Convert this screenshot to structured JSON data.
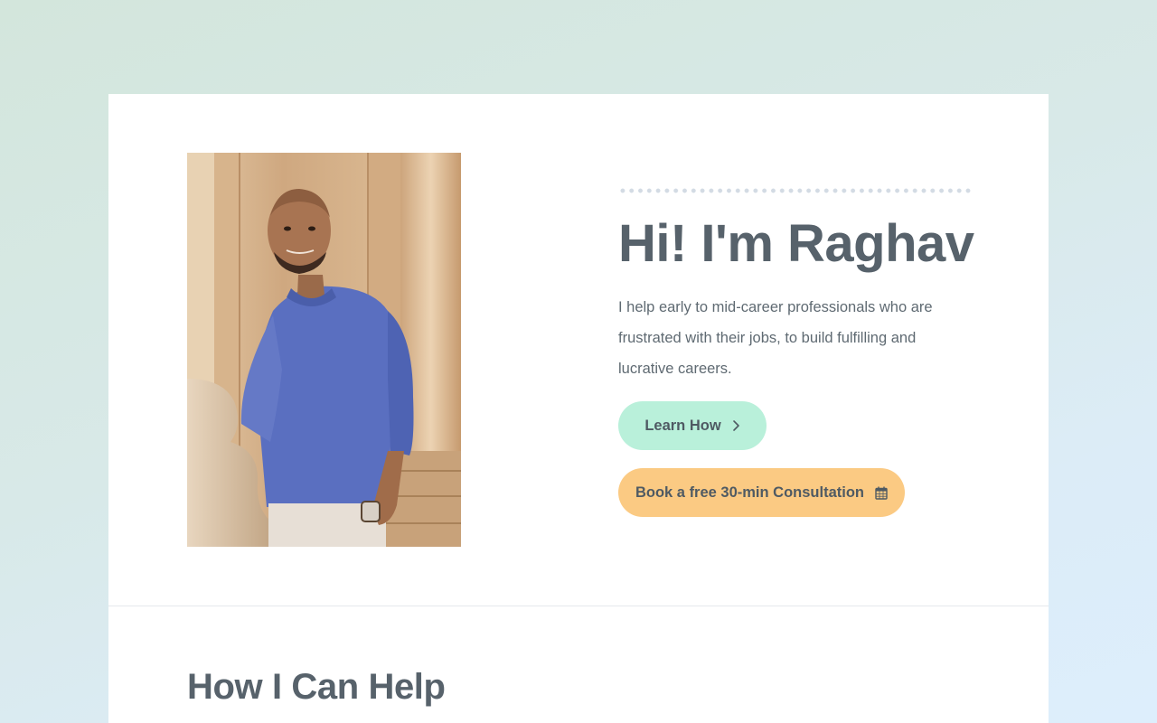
{
  "hero": {
    "portrait_alt": "Portrait of Raghav",
    "title": "Hi! I'm Raghav",
    "description": "I help early to mid-career professionals who are frustrated with their jobs, to build fulfilling and lucrative careers.",
    "primary_button": {
      "label": "Learn How",
      "icon": "chevron-right-icon",
      "color": "#b9f0da"
    },
    "secondary_button": {
      "label": "Book a free 30-min Consultation",
      "icon": "calendar-icon",
      "color": "#fbca83"
    }
  },
  "services": {
    "title": "How I Can Help"
  },
  "colors": {
    "text": "#535f69",
    "accent_green": "#b9f0da",
    "accent_orange": "#fbca83"
  }
}
